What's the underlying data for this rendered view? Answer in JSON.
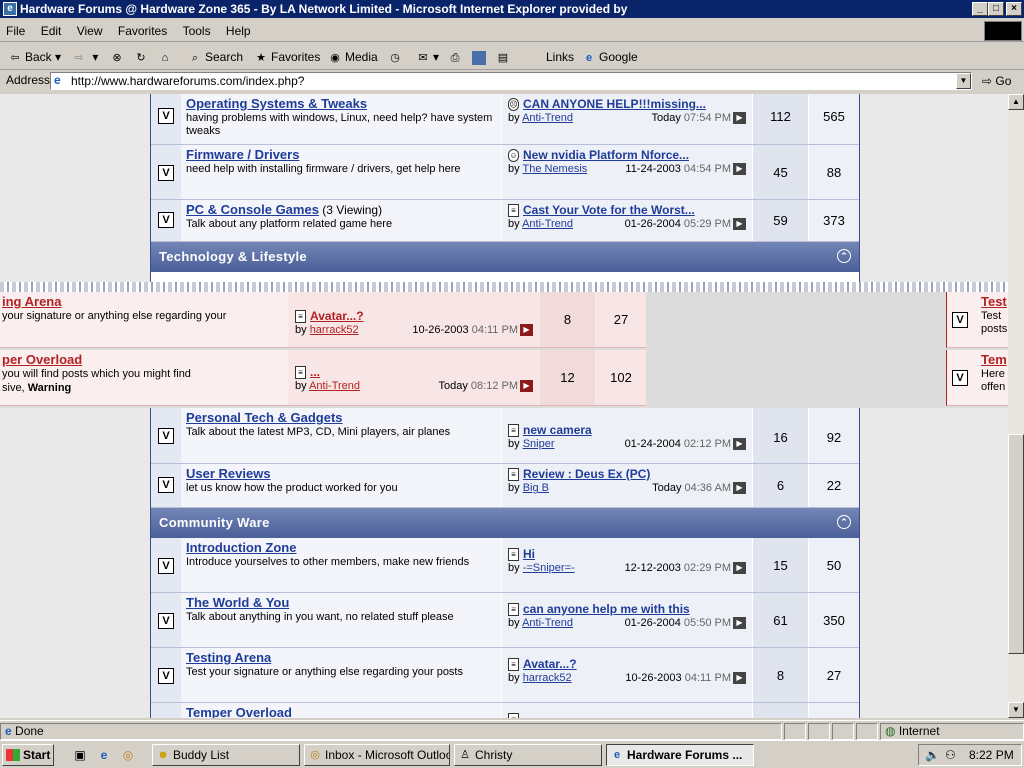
{
  "window": {
    "title": "Hardware Forums @ Hardware Zone 365 - By LA Network Limited - Microsoft Internet Explorer provided by"
  },
  "menu": [
    "File",
    "Edit",
    "View",
    "Favorites",
    "Tools",
    "Help"
  ],
  "toolbar": {
    "back": "Back",
    "search": "Search",
    "favorites": "Favorites",
    "media": "Media",
    "links": "Links",
    "google": "Google"
  },
  "address": {
    "label": "Address",
    "url": "http://www.hardwareforums.com/index.php?",
    "go": "Go"
  },
  "forums_top": [
    {
      "title": "Operating Systems & Tweaks",
      "viewing": "",
      "desc": "having problems with windows, Linux, need help? have system tweaks",
      "post_title": "CAN ANYONE HELP!!!missing...",
      "by": "by",
      "poster": "Anti-Trend",
      "date": "Today",
      "time": "07:54 PM",
      "threads": "112",
      "posts": "565",
      "icon": "sad"
    },
    {
      "title": "Firmware / Drivers",
      "viewing": "",
      "desc": "need help with installing firmware / drivers, get help here",
      "post_title": "New nvidia Platform Nforce...",
      "by": "by",
      "poster": "The Nemesis",
      "date": "11-24-2003",
      "time": "04:54 PM",
      "threads": "45",
      "posts": "88",
      "icon": "smile"
    },
    {
      "title": "PC & Console Games",
      "viewing": "(3 Viewing)",
      "desc": "Talk about any platform related game here",
      "post_title": "Cast Your Vote for the Worst...",
      "by": "by",
      "poster": "Anti-Trend",
      "date": "01-26-2004",
      "time": "05:29 PM",
      "threads": "59",
      "posts": "373",
      "icon": "doc"
    }
  ],
  "category_tech": {
    "title": "Technology & Lifestyle"
  },
  "overlay_rows": [
    {
      "title": "ing Arena",
      "desc": "your signature or anything else regarding your",
      "post_title": "Avatar...?",
      "by": "by",
      "poster": "harrack52",
      "date": "10-26-2003",
      "time": "04:11 PM",
      "threads": "8",
      "posts": "27"
    },
    {
      "title": "per Overload",
      "desc": "you will find posts which you might find",
      "desc2": "sive,",
      "warning": "Warning",
      "post_title": "...",
      "by": "by",
      "poster": "Anti-Trend",
      "date": "Today",
      "time": "08:12 PM",
      "threads": "12",
      "posts": "102"
    }
  ],
  "overlay_right": [
    {
      "title": "Test",
      "desc": "Test",
      "desc2": "posts"
    },
    {
      "title": "Tem",
      "desc": "Here",
      "desc2": "offen"
    }
  ],
  "forums_tech": [
    {
      "title": "Personal Tech & Gadgets",
      "viewing": "",
      "desc": "Talk about the latest MP3, CD, Mini players, air planes",
      "post_title": "new camera",
      "by": "by",
      "poster": "Sniper",
      "date": "01-24-2004",
      "time": "02:12 PM",
      "threads": "16",
      "posts": "92",
      "icon": "doc"
    },
    {
      "title": "User Reviews",
      "viewing": "",
      "desc": "let us know how the product worked for you",
      "post_title": "Review : Deus Ex (PC)",
      "by": "by",
      "poster": "Big B",
      "date": "Today",
      "time": "04:36 AM",
      "threads": "6",
      "posts": "22",
      "icon": "doc"
    }
  ],
  "category_community": {
    "title": "Community Ware"
  },
  "forums_community": [
    {
      "title": "Introduction Zone",
      "viewing": "",
      "desc": "Introduce yourselves to other members, make new friends",
      "post_title": "Hi",
      "by": "by",
      "poster": "-=Sniper=-",
      "date": "12-12-2003",
      "time": "02:29 PM",
      "threads": "15",
      "posts": "50",
      "icon": "doc"
    },
    {
      "title": "The World & You",
      "viewing": "",
      "desc": "Talk about anything in you want, no related stuff please",
      "post_title": "can anyone help me with this",
      "by": "by",
      "poster": "Anti-Trend",
      "date": "01-26-2004",
      "time": "05:50 PM",
      "threads": "61",
      "posts": "350",
      "icon": "doc"
    },
    {
      "title": "Testing Arena",
      "viewing": "",
      "desc": "Test your signature or anything else regarding your posts",
      "post_title": "Avatar...?",
      "by": "by",
      "poster": "harrack52",
      "date": "10-26-2003",
      "time": "04:11 PM",
      "threads": "8",
      "posts": "27",
      "icon": "doc"
    },
    {
      "title": "Temper Overload",
      "viewing": "",
      "desc": "",
      "post_title": "",
      "by": "",
      "poster": "",
      "date": "",
      "time": "",
      "threads": "",
      "posts": "",
      "icon": "doc"
    }
  ],
  "status": {
    "text": "Done",
    "zone": "Internet"
  },
  "taskbar": {
    "start": "Start",
    "buttons": [
      "Buddy List",
      "Inbox - Microsoft Outlook",
      "Christy",
      "Hardware Forums ..."
    ],
    "clock": "8:22 PM"
  },
  "colors": {
    "title_bg": "#0a246a",
    "cat_head": "#5a6ea6",
    "link": "#1f3c99",
    "overlay_link": "#b22222"
  }
}
